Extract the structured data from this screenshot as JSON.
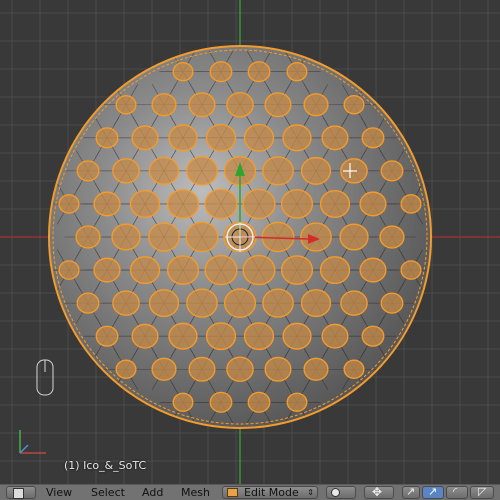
{
  "viewport": {
    "object_label": "(1) Ico_&_SoTC",
    "colors": {
      "background": "#393939",
      "grid": "#4c4c4c",
      "x_axis": "#a83232",
      "y_axis": "#3fa53f",
      "selected_edge": "#f39b2c",
      "selected_face": "#c78a46",
      "mesh_surface": "#6f6f6f"
    },
    "cursor_icon": "crosshair-cursor-icon",
    "manipulator_icon": "translate-manipulator-icon",
    "axis_gizmo_icon": "view-axis-gizmo-icon",
    "mouse_hint_icon": "mouse-icon"
  },
  "header": {
    "editor_type_icon": "3d-view-icon",
    "menus": [
      "View",
      "Select",
      "Add",
      "Mesh"
    ],
    "mode": "Edit Mode",
    "mode_icon": "edit-mode-icon",
    "shading_icon": "solid-shading-icon",
    "pivot_icon": "pivot-point-icon",
    "manipulator_icons": [
      "manipulator-toggle-icon",
      "translate-icon",
      "rotate-icon",
      "scale-icon"
    ]
  }
}
